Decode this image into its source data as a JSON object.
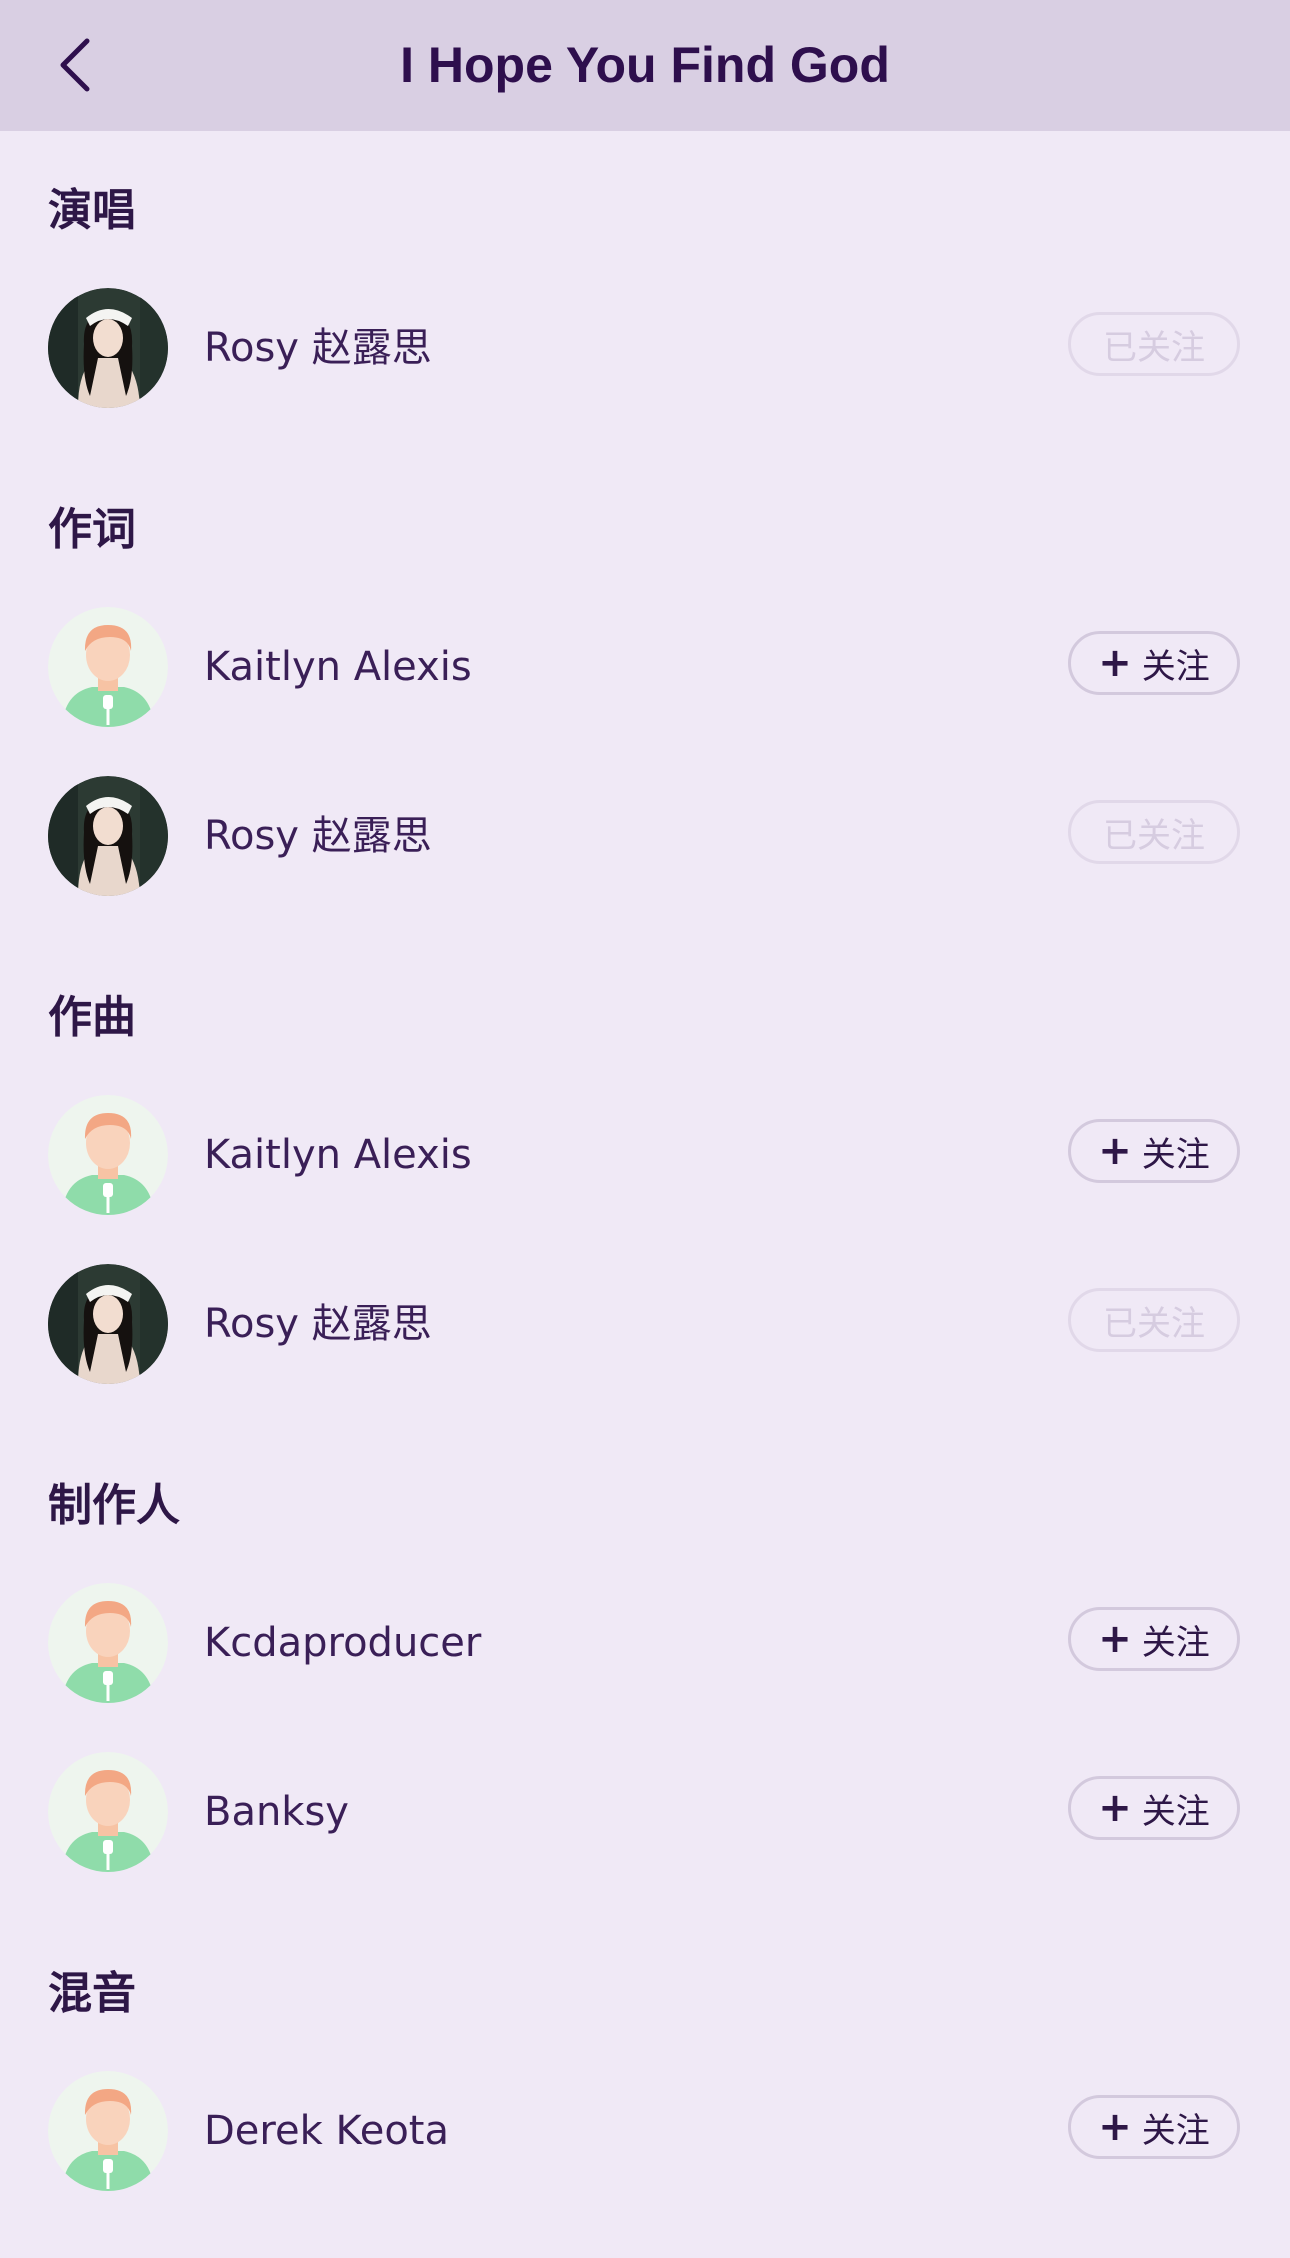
{
  "header": {
    "title": "I Hope You Find God",
    "back_icon": "chevron-left-icon"
  },
  "sections": [
    {
      "title": "演唱",
      "people": [
        {
          "name": "Rosy 赵露思",
          "avatar": "photo-avatar",
          "button": "已关注",
          "followed": true
        }
      ]
    },
    {
      "title": "作词",
      "people": [
        {
          "name": "Kaitlyn Alexis",
          "avatar": "default-avatar",
          "button": "关注",
          "followed": false
        },
        {
          "name": "Rosy 赵露思",
          "avatar": "photo-avatar",
          "button": "已关注",
          "followed": true
        }
      ]
    },
    {
      "title": "作曲",
      "people": [
        {
          "name": "Kaitlyn Alexis",
          "avatar": "default-avatar",
          "button": "关注",
          "followed": false
        },
        {
          "name": "Rosy 赵露思",
          "avatar": "photo-avatar",
          "button": "已关注",
          "followed": true
        }
      ]
    },
    {
      "title": "制作人",
      "people": [
        {
          "name": "Kcdaproducer",
          "avatar": "default-avatar",
          "button": "关注",
          "followed": false
        },
        {
          "name": "Banksy",
          "avatar": "default-avatar",
          "button": "关注",
          "followed": false
        }
      ]
    },
    {
      "title": "混音",
      "people": [
        {
          "name": "Derek Keota",
          "avatar": "default-avatar",
          "button": "关注",
          "followed": false
        }
      ]
    }
  ],
  "colors": {
    "background": "#f0e9f6",
    "header": "#d9cfe3",
    "title": "#2e0f4d"
  }
}
